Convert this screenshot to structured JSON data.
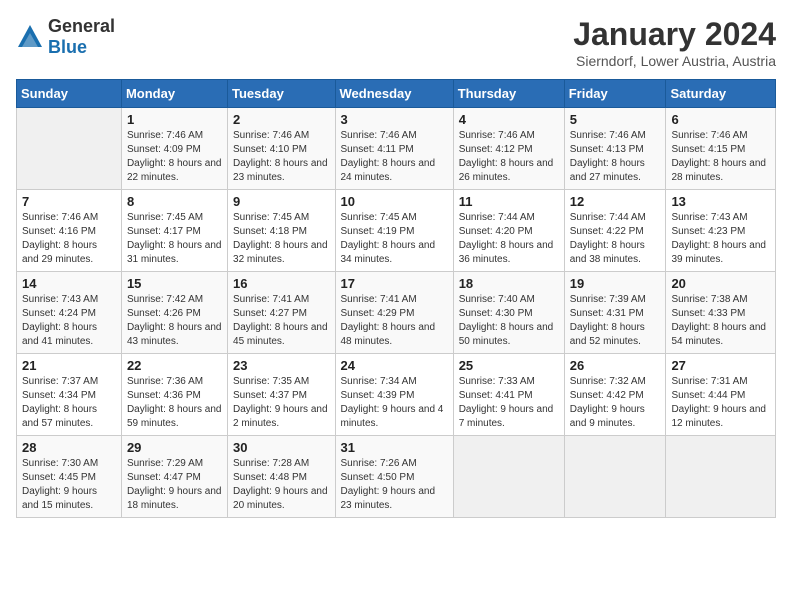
{
  "logo": {
    "general": "General",
    "blue": "Blue"
  },
  "header": {
    "title": "January 2024",
    "subtitle": "Sierndorf, Lower Austria, Austria"
  },
  "weekdays": [
    "Sunday",
    "Monday",
    "Tuesday",
    "Wednesday",
    "Thursday",
    "Friday",
    "Saturday"
  ],
  "weeks": [
    [
      {
        "day": "",
        "empty": true
      },
      {
        "day": "1",
        "sunrise": "Sunrise: 7:46 AM",
        "sunset": "Sunset: 4:09 PM",
        "daylight": "Daylight: 8 hours and 22 minutes."
      },
      {
        "day": "2",
        "sunrise": "Sunrise: 7:46 AM",
        "sunset": "Sunset: 4:10 PM",
        "daylight": "Daylight: 8 hours and 23 minutes."
      },
      {
        "day": "3",
        "sunrise": "Sunrise: 7:46 AM",
        "sunset": "Sunset: 4:11 PM",
        "daylight": "Daylight: 8 hours and 24 minutes."
      },
      {
        "day": "4",
        "sunrise": "Sunrise: 7:46 AM",
        "sunset": "Sunset: 4:12 PM",
        "daylight": "Daylight: 8 hours and 26 minutes."
      },
      {
        "day": "5",
        "sunrise": "Sunrise: 7:46 AM",
        "sunset": "Sunset: 4:13 PM",
        "daylight": "Daylight: 8 hours and 27 minutes."
      },
      {
        "day": "6",
        "sunrise": "Sunrise: 7:46 AM",
        "sunset": "Sunset: 4:15 PM",
        "daylight": "Daylight: 8 hours and 28 minutes."
      }
    ],
    [
      {
        "day": "7",
        "sunrise": "Sunrise: 7:46 AM",
        "sunset": "Sunset: 4:16 PM",
        "daylight": "Daylight: 8 hours and 29 minutes."
      },
      {
        "day": "8",
        "sunrise": "Sunrise: 7:45 AM",
        "sunset": "Sunset: 4:17 PM",
        "daylight": "Daylight: 8 hours and 31 minutes."
      },
      {
        "day": "9",
        "sunrise": "Sunrise: 7:45 AM",
        "sunset": "Sunset: 4:18 PM",
        "daylight": "Daylight: 8 hours and 32 minutes."
      },
      {
        "day": "10",
        "sunrise": "Sunrise: 7:45 AM",
        "sunset": "Sunset: 4:19 PM",
        "daylight": "Daylight: 8 hours and 34 minutes."
      },
      {
        "day": "11",
        "sunrise": "Sunrise: 7:44 AM",
        "sunset": "Sunset: 4:20 PM",
        "daylight": "Daylight: 8 hours and 36 minutes."
      },
      {
        "day": "12",
        "sunrise": "Sunrise: 7:44 AM",
        "sunset": "Sunset: 4:22 PM",
        "daylight": "Daylight: 8 hours and 38 minutes."
      },
      {
        "day": "13",
        "sunrise": "Sunrise: 7:43 AM",
        "sunset": "Sunset: 4:23 PM",
        "daylight": "Daylight: 8 hours and 39 minutes."
      }
    ],
    [
      {
        "day": "14",
        "sunrise": "Sunrise: 7:43 AM",
        "sunset": "Sunset: 4:24 PM",
        "daylight": "Daylight: 8 hours and 41 minutes."
      },
      {
        "day": "15",
        "sunrise": "Sunrise: 7:42 AM",
        "sunset": "Sunset: 4:26 PM",
        "daylight": "Daylight: 8 hours and 43 minutes."
      },
      {
        "day": "16",
        "sunrise": "Sunrise: 7:41 AM",
        "sunset": "Sunset: 4:27 PM",
        "daylight": "Daylight: 8 hours and 45 minutes."
      },
      {
        "day": "17",
        "sunrise": "Sunrise: 7:41 AM",
        "sunset": "Sunset: 4:29 PM",
        "daylight": "Daylight: 8 hours and 48 minutes."
      },
      {
        "day": "18",
        "sunrise": "Sunrise: 7:40 AM",
        "sunset": "Sunset: 4:30 PM",
        "daylight": "Daylight: 8 hours and 50 minutes."
      },
      {
        "day": "19",
        "sunrise": "Sunrise: 7:39 AM",
        "sunset": "Sunset: 4:31 PM",
        "daylight": "Daylight: 8 hours and 52 minutes."
      },
      {
        "day": "20",
        "sunrise": "Sunrise: 7:38 AM",
        "sunset": "Sunset: 4:33 PM",
        "daylight": "Daylight: 8 hours and 54 minutes."
      }
    ],
    [
      {
        "day": "21",
        "sunrise": "Sunrise: 7:37 AM",
        "sunset": "Sunset: 4:34 PM",
        "daylight": "Daylight: 8 hours and 57 minutes."
      },
      {
        "day": "22",
        "sunrise": "Sunrise: 7:36 AM",
        "sunset": "Sunset: 4:36 PM",
        "daylight": "Daylight: 8 hours and 59 minutes."
      },
      {
        "day": "23",
        "sunrise": "Sunrise: 7:35 AM",
        "sunset": "Sunset: 4:37 PM",
        "daylight": "Daylight: 9 hours and 2 minutes."
      },
      {
        "day": "24",
        "sunrise": "Sunrise: 7:34 AM",
        "sunset": "Sunset: 4:39 PM",
        "daylight": "Daylight: 9 hours and 4 minutes."
      },
      {
        "day": "25",
        "sunrise": "Sunrise: 7:33 AM",
        "sunset": "Sunset: 4:41 PM",
        "daylight": "Daylight: 9 hours and 7 minutes."
      },
      {
        "day": "26",
        "sunrise": "Sunrise: 7:32 AM",
        "sunset": "Sunset: 4:42 PM",
        "daylight": "Daylight: 9 hours and 9 minutes."
      },
      {
        "day": "27",
        "sunrise": "Sunrise: 7:31 AM",
        "sunset": "Sunset: 4:44 PM",
        "daylight": "Daylight: 9 hours and 12 minutes."
      }
    ],
    [
      {
        "day": "28",
        "sunrise": "Sunrise: 7:30 AM",
        "sunset": "Sunset: 4:45 PM",
        "daylight": "Daylight: 9 hours and 15 minutes."
      },
      {
        "day": "29",
        "sunrise": "Sunrise: 7:29 AM",
        "sunset": "Sunset: 4:47 PM",
        "daylight": "Daylight: 9 hours and 18 minutes."
      },
      {
        "day": "30",
        "sunrise": "Sunrise: 7:28 AM",
        "sunset": "Sunset: 4:48 PM",
        "daylight": "Daylight: 9 hours and 20 minutes."
      },
      {
        "day": "31",
        "sunrise": "Sunrise: 7:26 AM",
        "sunset": "Sunset: 4:50 PM",
        "daylight": "Daylight: 9 hours and 23 minutes."
      },
      {
        "day": "",
        "empty": true
      },
      {
        "day": "",
        "empty": true
      },
      {
        "day": "",
        "empty": true
      }
    ]
  ]
}
